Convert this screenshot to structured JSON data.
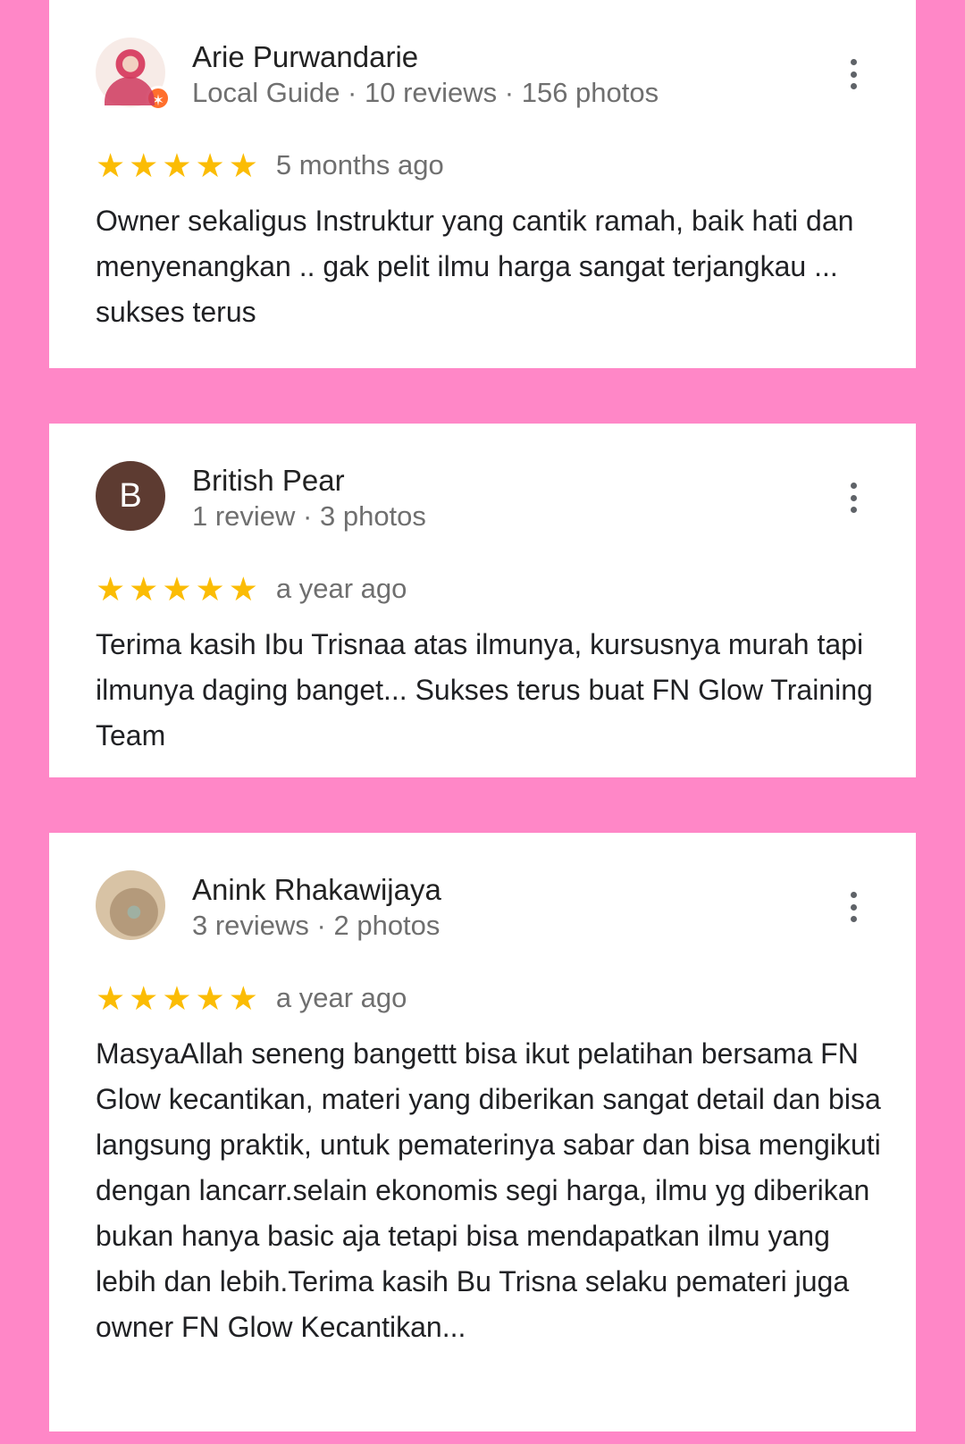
{
  "reviews": [
    {
      "name": "Arie Purwandarie",
      "meta": "Local Guide · 10 reviews · 156 photos",
      "avatar": {
        "type": "photo",
        "badge": "local-guide-badge"
      },
      "rating": 5,
      "time": "5 months ago",
      "text": "Owner sekaligus Instruktur yang cantik ramah, baik hati dan menyenangkan .. gak pelit ilmu harga sangat terjangkau ... sukses terus"
    },
    {
      "name": "British Pear",
      "meta": "1 review · 3 photos",
      "avatar": {
        "type": "letter",
        "letter": "B",
        "color": "#5d3b31"
      },
      "rating": 5,
      "time": "a year ago",
      "text": "Terima kasih Ibu Trisnaa atas ilmunya, kursusnya murah tapi ilmunya daging banget... Sukses terus buat FN Glow Training Team"
    },
    {
      "name": "Anink Rhakawijaya",
      "meta": "3 reviews · 2 photos",
      "avatar": {
        "type": "photo"
      },
      "rating": 5,
      "time": "a year ago",
      "text": "MasyaAllah seneng bangettt bisa ikut pelatihan bersama FN Glow kecantikan, materi yang diberikan sangat detail dan bisa langsung praktik, untuk pematerinya sabar dan bisa mengikuti dengan lancarr.selain ekonomis segi harga, ilmu yg diberikan bukan hanya basic aja tetapi bisa mendapatkan ilmu yang lebih dan lebih.Terima kasih Bu Trisna selaku pemateri juga owner FN Glow Kecantikan..."
    }
  ],
  "colors": {
    "background": "#ff87c7",
    "star": "#fbbc04",
    "card": "#ffffff",
    "secondary_text": "#6f6f6f"
  },
  "icons": {
    "more_options": "more-vert-icon",
    "star": "star-icon"
  }
}
